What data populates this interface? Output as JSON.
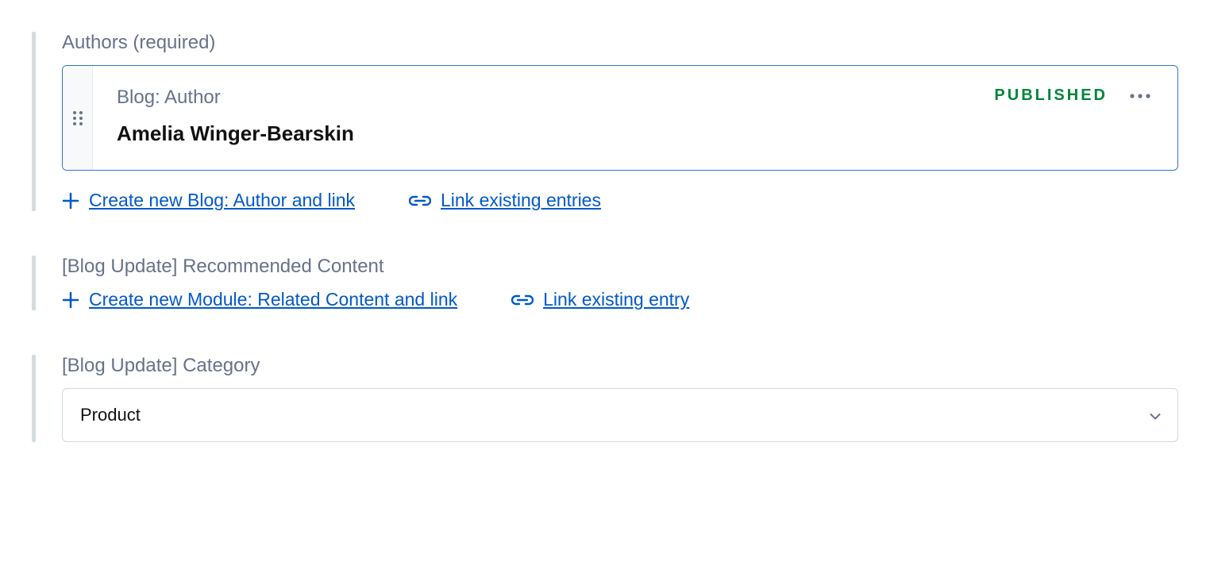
{
  "authors": {
    "label": "Authors (required)",
    "entry": {
      "content_type": "Blog: Author",
      "title": "Amelia Winger-Bearskin",
      "status": "PUBLISHED"
    },
    "create_label": "Create new Blog: Author and link",
    "link_label": "Link existing entries"
  },
  "recommended": {
    "label": "[Blog Update] Recommended Content",
    "create_label": "Create new Module: Related Content and link",
    "link_label": "Link existing entry"
  },
  "category": {
    "label": "[Blog Update] Category",
    "selected": "Product"
  }
}
